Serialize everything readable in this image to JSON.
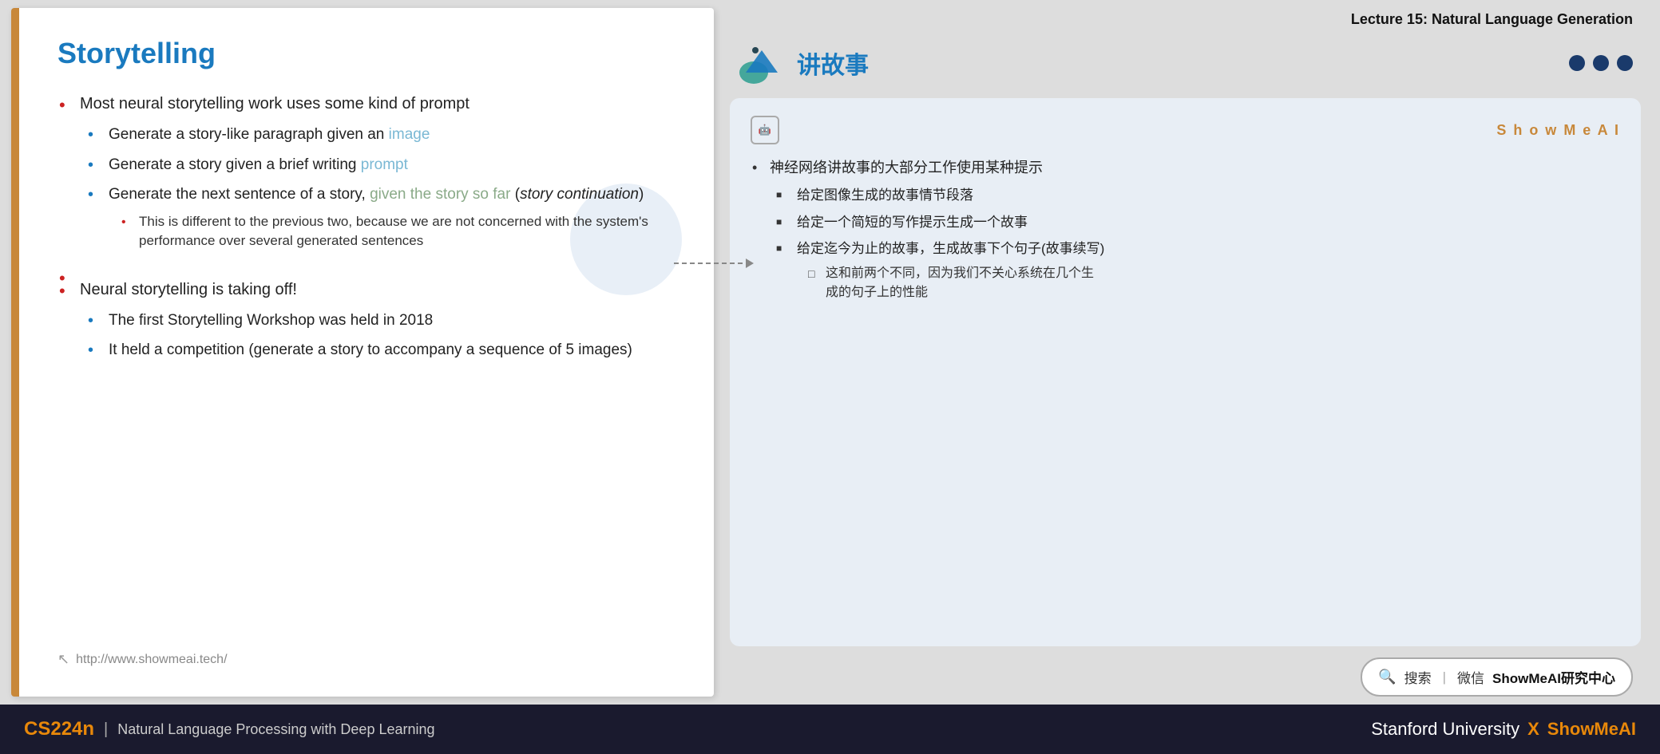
{
  "slide": {
    "title": "Storytelling",
    "left_border_color": "#c8883a",
    "bullets": [
      {
        "text": "Most neural storytelling work uses some kind of prompt",
        "sub_bullets": [
          {
            "text_parts": [
              "Generate a story-like paragraph given an ",
              "image"
            ],
            "highlight": "image"
          },
          {
            "text_parts": [
              "Generate a story given a brief writing ",
              "prompt"
            ],
            "highlight": "prompt"
          },
          {
            "text_parts": [
              "Generate the next sentence of a story, ",
              "given the story so far",
              " (",
              "story continuation",
              ")"
            ],
            "highlight": "given"
          },
          {
            "text": "This is different to the previous two, because we are not concerned with the system's performance over several generated sentences",
            "level": 3
          }
        ]
      },
      {
        "text": "Neural storytelling is taking off!",
        "sub_bullets": [
          {
            "text": "The first Storytelling Workshop was held in 2018"
          },
          {
            "text": "It held a competition (generate a story to accompany a sequence of 5 images)"
          }
        ]
      }
    ],
    "footer_url": "http://www.showmeai.tech/"
  },
  "right_panel": {
    "lecture_title": "Lecture 15: Natural Language Generation",
    "chinese_title": "讲故事",
    "dots": [
      "active",
      "active",
      "active"
    ],
    "translation_card": {
      "ai_badge": "AI",
      "showmeai_label": "S h o w M e A I",
      "cn_bullets": [
        {
          "text": "神经网络讲故事的大部分工作使用某种提示",
          "sub_items": [
            {
              "text": "给定图像生成的故事情节段落"
            },
            {
              "text": "给定一个简短的写作提示生成一个故事"
            },
            {
              "text": "给定迄今为止的故事，生成故事下个句子(故事续写)",
              "sub_sub": [
                {
                  "text": "这和前两个不同，因为我们不关心系统在几个生成的句子上的性能"
                }
              ]
            }
          ]
        }
      ]
    },
    "search_box": {
      "icon": "🔍",
      "text": "搜索 | 微信",
      "bold_text": "ShowMeAI研究中心"
    }
  },
  "bottom_bar": {
    "cs224n": "CS224n",
    "divider": "|",
    "subtitle": "Natural Language Processing with Deep Learning",
    "university": "Stanford University",
    "x": "X",
    "showmeai": "ShowMeAI"
  }
}
